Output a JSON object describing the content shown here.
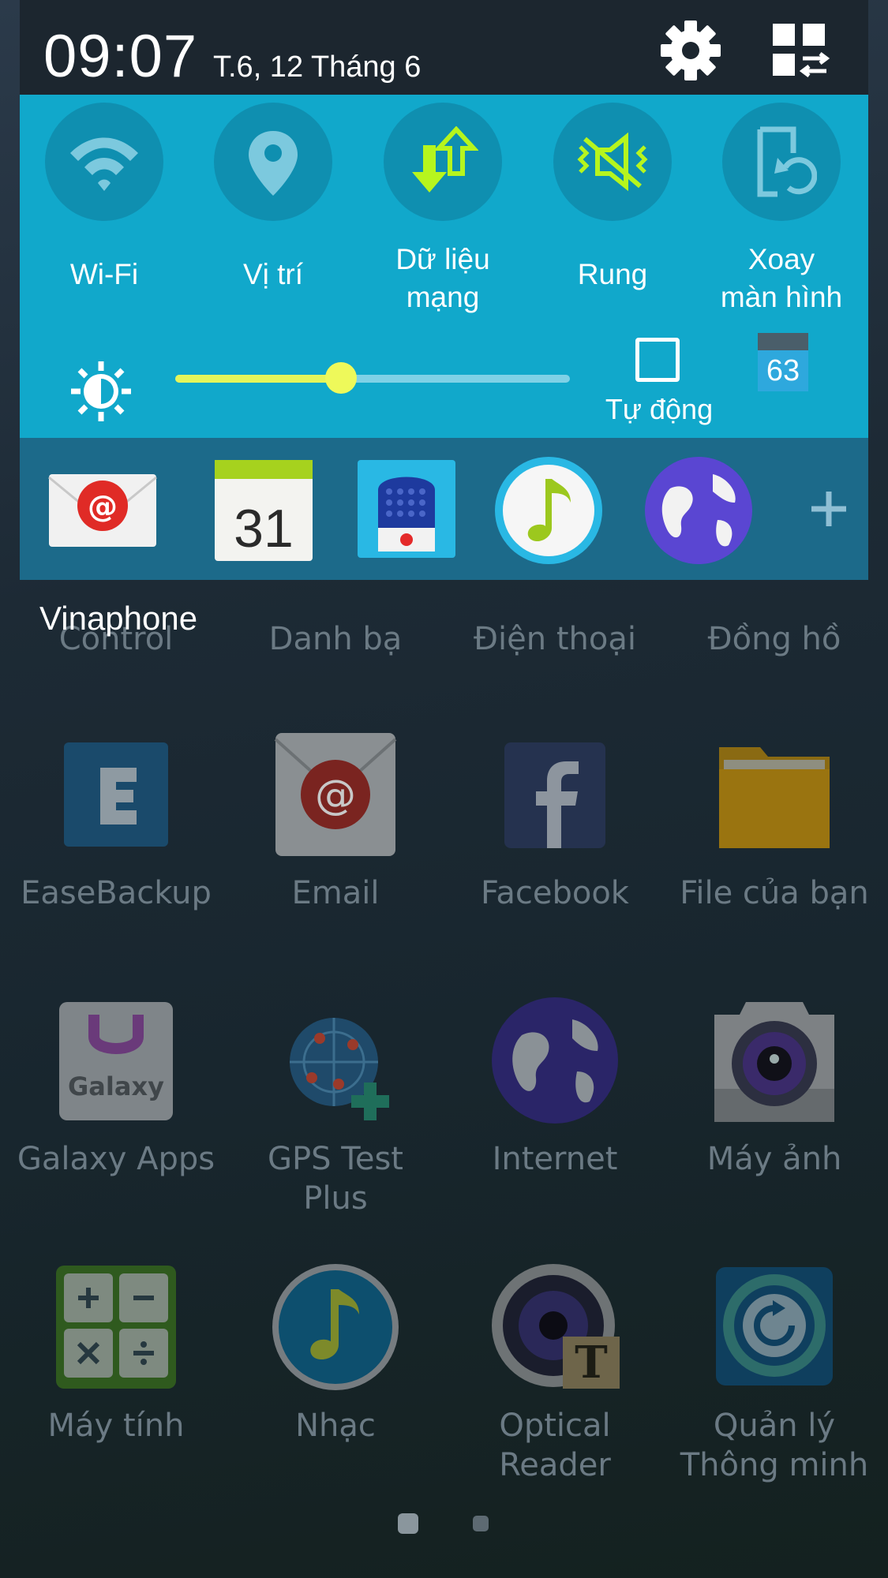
{
  "status_bar": {
    "time": "09:07",
    "date": "T.6, 12 Tháng 6"
  },
  "quick_settings": [
    {
      "name": "wifi",
      "label": "Wi-Fi"
    },
    {
      "name": "location",
      "label": "Vị trí"
    },
    {
      "name": "mobile-data",
      "label": "Dữ liệu mạng"
    },
    {
      "name": "vibrate",
      "label": "Rung"
    },
    {
      "name": "rotate",
      "label": "Xoay màn hình"
    }
  ],
  "brightness": {
    "level": 0.42,
    "auto_label": "Tự động",
    "auto_checked": false,
    "badge_value": "63"
  },
  "shortcut_apps": [
    {
      "icon": "email-icon"
    },
    {
      "icon": "calendar-icon",
      "text": "31"
    },
    {
      "icon": "voice-recorder-icon"
    },
    {
      "icon": "music-icon"
    },
    {
      "icon": "internet-icon"
    }
  ],
  "carrier": "Vinaphone",
  "apps_partial": [
    "Control",
    "Danh bạ",
    "Điện thoại",
    "Đồng hồ"
  ],
  "apps": [
    [
      "EaseBackup",
      "Email",
      "Facebook",
      "File của bạn"
    ],
    [
      "Galaxy Apps",
      "GPS Test Plus",
      "Internet",
      "Máy ảnh"
    ],
    [
      "Máy tính",
      "Nhạc",
      "Optical Reader",
      "Quản lý Thông minh"
    ]
  ],
  "galaxy_icon_text": "Galaxy",
  "page_indicator": {
    "pages": 2,
    "current": 1
  },
  "colors": {
    "panel": "#11a8cb",
    "statusbar": "#1c262f",
    "shortcuts": "#1c6a8a",
    "accent": "#e4f55a"
  }
}
